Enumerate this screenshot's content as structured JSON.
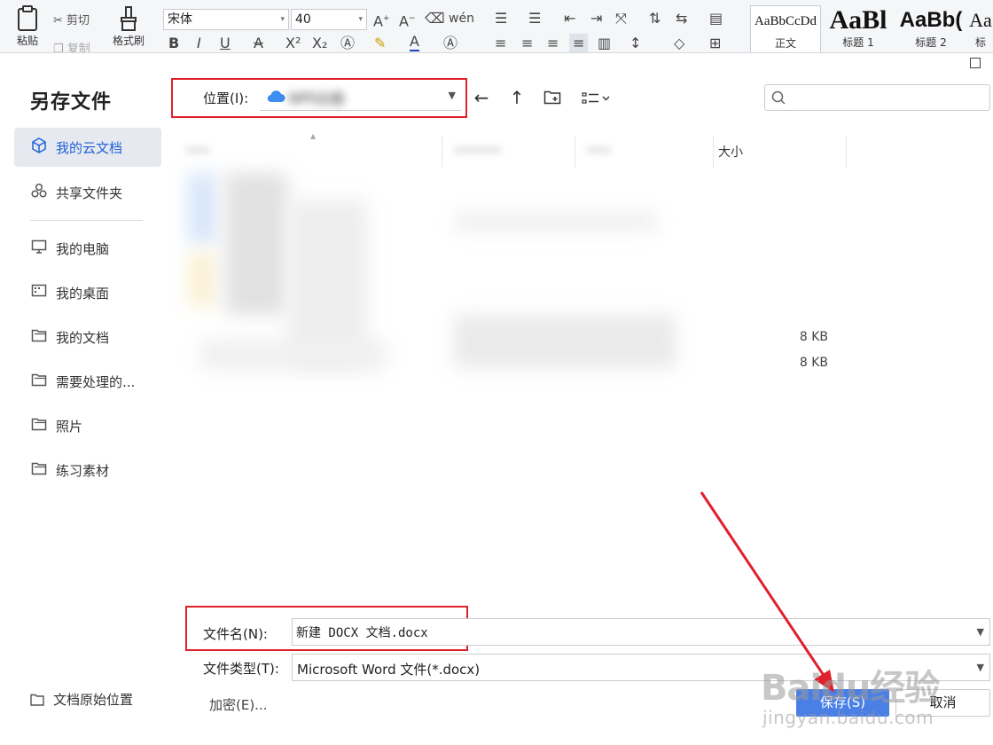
{
  "ribbon": {
    "paste_label": "粘贴",
    "cut_label": "剪切",
    "copy_label": "复制",
    "format_painter_label": "格式刷",
    "font_family": "宋体",
    "font_size": "40",
    "styles": [
      {
        "preview": "AaBbCcDd",
        "label": "正文"
      },
      {
        "preview": "AaBl",
        "label": "标题 1"
      },
      {
        "preview": "AaBb(",
        "label": "标题 2"
      },
      {
        "preview": "Aa",
        "label": "标"
      }
    ]
  },
  "dialog": {
    "title": "另存文件",
    "location_label": "位置(I):",
    "location_value": "WPS云盘",
    "search_placeholder": ""
  },
  "sidebar": {
    "items": [
      {
        "label": "我的云文档",
        "icon": "cloud-cube-icon",
        "active": true
      },
      {
        "label": "共享文件夹",
        "icon": "share-icon"
      },
      {
        "label": "我的电脑",
        "icon": "monitor-icon"
      },
      {
        "label": "我的桌面",
        "icon": "desktop-icon"
      },
      {
        "label": "我的文档",
        "icon": "folder-icon"
      },
      {
        "label": "需要处理的...",
        "icon": "folder-icon"
      },
      {
        "label": "照片",
        "icon": "folder-icon"
      },
      {
        "label": "练习素材",
        "icon": "folder-icon"
      }
    ],
    "origin_location": "文档原始位置"
  },
  "file_list": {
    "columns": {
      "size": "大小"
    },
    "sizes": [
      "8 KB",
      "8 KB"
    ]
  },
  "form": {
    "filename_label": "文件名(N):",
    "filename_value": "新建 DOCX 文档.docx",
    "filetype_label": "文件类型(T):",
    "filetype_value": "Microsoft Word 文件(*.docx)",
    "encrypt_label": "加密(E)...",
    "save_label": "保存(S)",
    "cancel_label": "取消"
  },
  "watermark": {
    "logo": "Baidu经验",
    "sub": "jingyan.baidu.com"
  },
  "colors": {
    "accent": "#1f62d8",
    "save_button": "#4a7fe6",
    "highlight_red": "#e0202a",
    "active_nav_bg": "#e6e9ef"
  }
}
